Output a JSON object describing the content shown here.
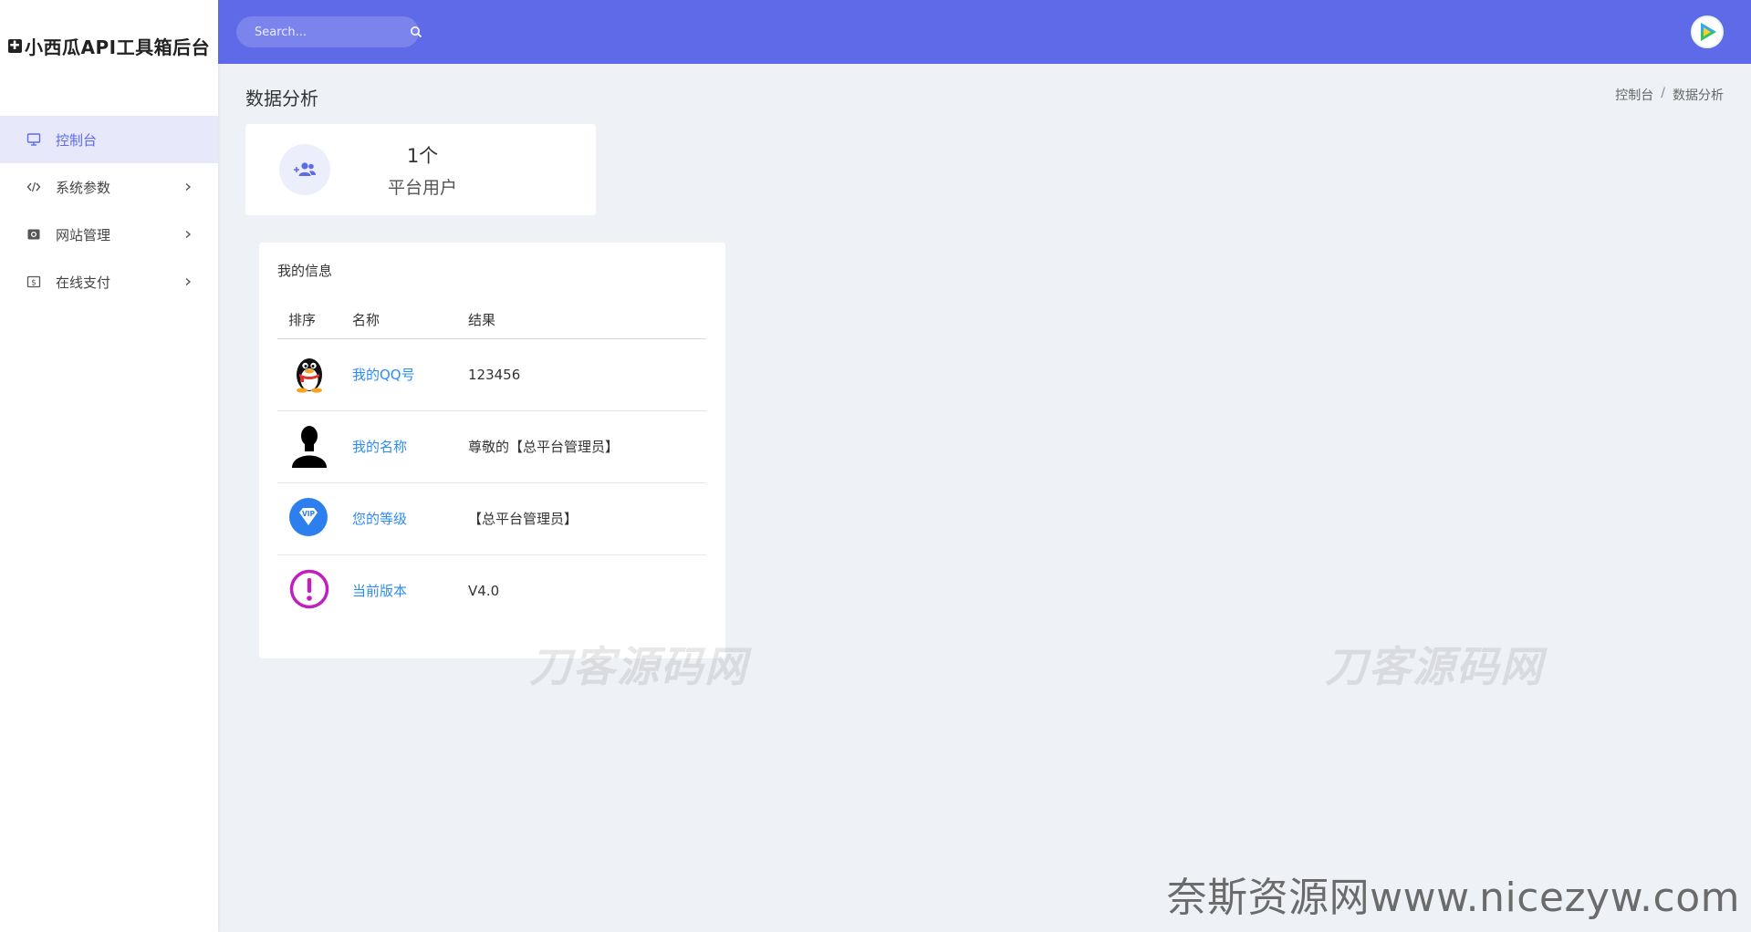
{
  "brand": {
    "title": "小西瓜API工具箱后台",
    "logo_glyph": "✚"
  },
  "sidebar": {
    "items": [
      {
        "label": "控制台",
        "icon": "monitor-icon",
        "active": true,
        "has_children": false
      },
      {
        "label": "系统参数",
        "icon": "code-icon",
        "active": false,
        "has_children": true
      },
      {
        "label": "网站管理",
        "icon": "settings-box-icon",
        "active": false,
        "has_children": true
      },
      {
        "label": "在线支付",
        "icon": "dollar-box-icon",
        "active": false,
        "has_children": true
      }
    ]
  },
  "topbar": {
    "search_placeholder": "Search...",
    "accent_color": "#5e6ae8"
  },
  "page": {
    "title": "数据分析",
    "breadcrumb": [
      "控制台",
      "数据分析"
    ],
    "breadcrumb_sep": "/"
  },
  "stat": {
    "value": "1个",
    "label": "平台用户",
    "icon": "user-add-icon"
  },
  "info": {
    "title": "我的信息",
    "columns": [
      "排序",
      "名称",
      "结果"
    ],
    "rows": [
      {
        "icon": "qq-penguin-icon",
        "name": "我的QQ号",
        "result": "123456"
      },
      {
        "icon": "person-silhouette-icon",
        "name": "我的名称",
        "result": "尊敬的【总平台管理员】"
      },
      {
        "icon": "vip-diamond-icon",
        "name": "您的等级",
        "result": "【总平台管理员】"
      },
      {
        "icon": "exclamation-circle-icon",
        "name": "当前版本",
        "result": "V4.0"
      }
    ]
  },
  "watermarks": {
    "text": "刀客源码网",
    "footer": "奈斯资源网www.nicezyw.com"
  }
}
